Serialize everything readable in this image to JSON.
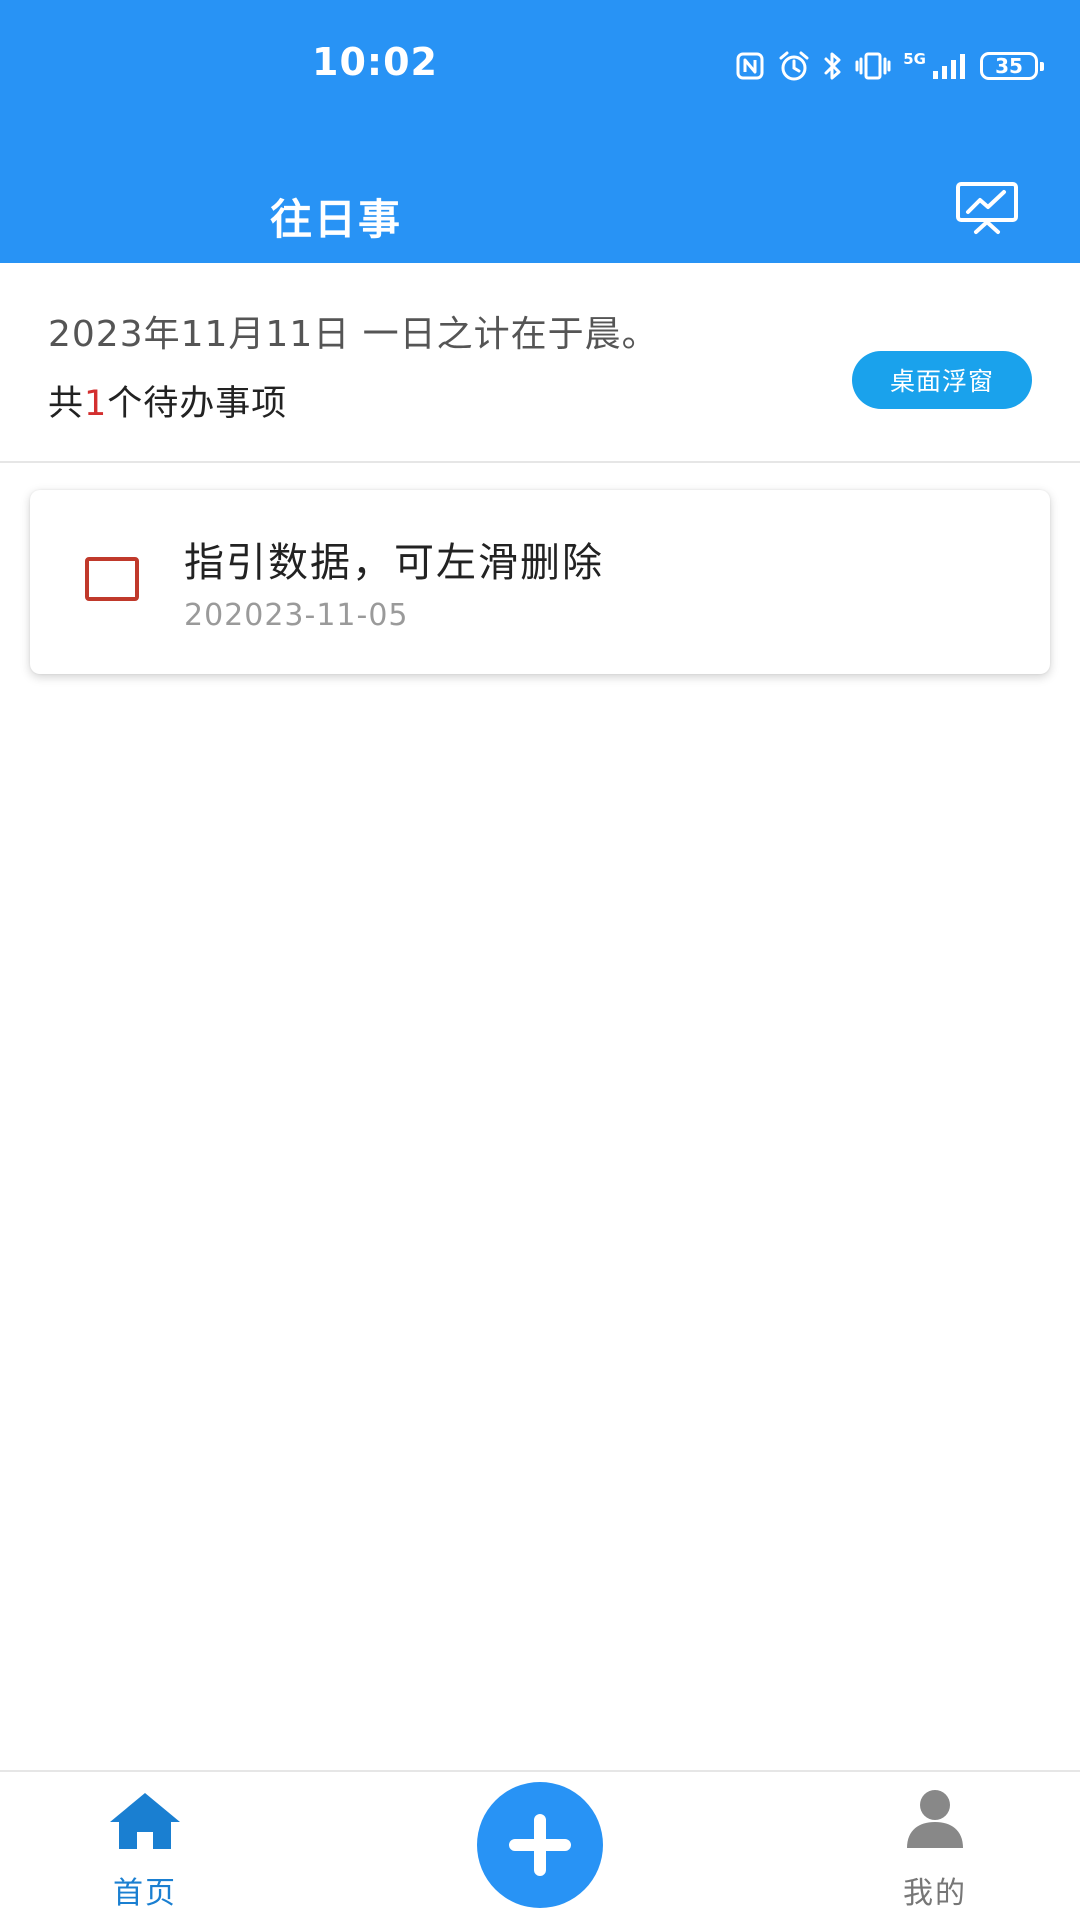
{
  "status_bar": {
    "time": "10:02",
    "network": "5G",
    "battery": "35",
    "icons": [
      "nfc-icon",
      "alarm-icon",
      "bluetooth-icon",
      "vibrate-icon",
      "signal-icon",
      "battery-icon"
    ]
  },
  "app_bar": {
    "title": "往日事",
    "action_icon": "chart-presentation-icon"
  },
  "summary": {
    "date_text": "2023年11月11日 一日之计在于晨。",
    "count_prefix": "共",
    "count": "1",
    "count_suffix": "个待办事项",
    "float_button_label": "桌面浮窗"
  },
  "todos": [
    {
      "title": "指引数据，可左滑删除",
      "date": "202023-11-05",
      "checked": false
    }
  ],
  "bottom_nav": {
    "home_label": "首页",
    "home_icon": "home-icon",
    "add_icon": "plus-icon",
    "mine_label": "我的",
    "mine_icon": "user-icon"
  },
  "colors": {
    "primary": "#2893f5",
    "float_button": "#1aa2ec",
    "count_highlight": "#d32f2f",
    "checkbox_border": "#c0392b",
    "nav_active": "#1a7fd1",
    "nav_inactive": "#777777"
  }
}
